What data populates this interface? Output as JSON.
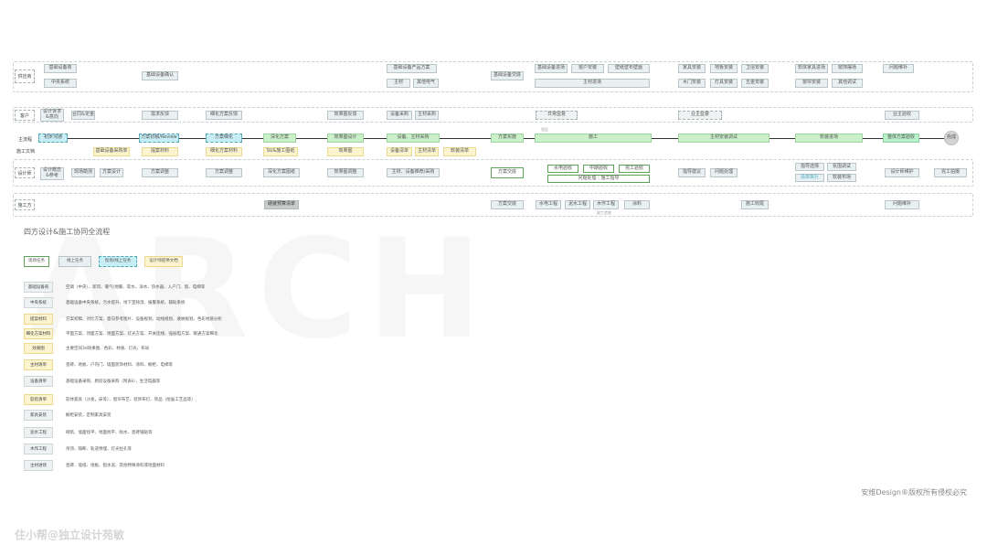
{
  "lanes": {
    "supplier": "供应商",
    "customer": "客户",
    "main_flow": "主流程",
    "designer": "设计师",
    "construction": "施工方",
    "side_main": "主流程",
    "side_doc": "施工文档"
  },
  "supplier_nodes": {
    "basic_equipment": "基础设备商",
    "central_system": "中央系统",
    "basic_confirm": "基础设备确认",
    "basic_product_plan": "基础设备产品方案",
    "main_material": "主材",
    "other_elec": "其他电气",
    "basic_handover": "基础设备交底",
    "basic_entry": "基础设备进场",
    "door_window_install": "窗户安装",
    "wall_cabinet_install": "壁纸壁布壁画",
    "main_material_entry": "主材进场",
    "furniture_install": "家具安装",
    "floor_install": "地板安装",
    "bath_install": "卫浴安装",
    "wood_door_install": "木门安装",
    "lamp_install": "灯具安装",
    "hardware_install": "五金安装",
    "soft_entry": "软体家具进场",
    "curtain": "窗饰摆场",
    "curtain_install": "窗帘安装",
    "other_debug": "其他调试",
    "issue_repair": "问题维补"
  },
  "customer_nodes": {
    "design_intent": "设计诉求\n&意向",
    "contract": "合同&定金",
    "needs_confirm": "需求反馈",
    "deepen_feedback": "细化方案反馈",
    "effect_feedback": "效果图反馈",
    "equip_purchase": "设备采购",
    "main_purchase": "主材采购",
    "daily_supervise": "日常监督",
    "owner_supervise": "业主监督",
    "owner_accept": "业主验收"
  },
  "main_nodes": {
    "first_comm": "初步沟通",
    "plan_proposal": "方案初稿/Review",
    "plan_deepen": "方案细化",
    "deep_plan": "深化方案",
    "effect_design": "效果图设计",
    "equip_main_purchase": "设备、主材采购",
    "plan_implement": "方案实施",
    "construction": "施工",
    "main_install": "主材安装调试",
    "soft_entry": "软装进场",
    "overall_accept": "整体方案验收",
    "finish": "完成",
    "arrow_label": "验证"
  },
  "doc_nodes": {
    "basic_list": "基础设备采购单",
    "proposal_material": "提案材料",
    "deepen_material": "细化方案材料",
    "cad_drawing": "SU&施工图纸",
    "effect_image": "效果图",
    "equip_list": "设备清单",
    "main_list": "主材清单",
    "soft_list": "软装清单"
  },
  "designer_nodes": {
    "design_concept": "设计概念\n&参考",
    "site_survey": "现场勘测",
    "plan_design": "方案设计",
    "plan_adjust": "方案调整",
    "plan_adjust2": "方案调整",
    "deep_drawing": "深化方案图纸",
    "effect_adjust": "效果图调整",
    "main_recommend": "主材、设备推荐/采购",
    "plan_handover": "方案交底",
    "hydro_accept": "水电验收",
    "mid_accept": "中期验收",
    "complete_accept": "完工验收",
    "issue_guide": "问题处理｜施工指导",
    "guide_suggest": "指导建议",
    "issue_handle": "问题处理",
    "guide_select": "指导选择",
    "checklist": "清单执行",
    "fixture_debug": "氛围调试",
    "soft_layout": "软装布场",
    "design_maintain": "设计师维护",
    "finish_shoot": "完工拍摄"
  },
  "construction_nodes": {
    "hard_budget": "硬装预算清单",
    "plan_handover": "方案交底",
    "hydro": "水电工程",
    "tile": "泥水工程",
    "wood": "木作工程",
    "paint": "涂料",
    "finish_clean": "施工收尾",
    "issue_repair": "问题维补",
    "tiny_mark": "竣工验收"
  },
  "section_title": "四方设计&施工协同全流程",
  "legend_types": {
    "offline": "现场任务",
    "online": "线上任务",
    "online_offline": "现场/线上任务",
    "design_doc": "设计师提供文档"
  },
  "legend": [
    {
      "tag": "基础设备商",
      "desc": "空调（中央）、新风、暖气/地暖、软水、净水、热水器、入户门、窗、电梯等",
      "yellow": false
    },
    {
      "tag": "中央系统",
      "desc": "基础设备中央系统，污水提升、地下室除湿、报警系统、辅助系统",
      "yellow": false
    },
    {
      "tag": "提案材料",
      "desc": "方案初稿、对比方案、意向参考图片、设备规划、动线规划、收纳规划、色彩材质分析",
      "yellow": true
    },
    {
      "tag": "细化方案材料",
      "desc": "平面方案、顶面方案、地面方案、灯光方案、开关连线、强弱电方案、暖通方案细化",
      "yellow": true
    },
    {
      "tag": "效果图",
      "desc": "主要空间3d效果图、色彩、材质、灯光、布局",
      "yellow": true
    },
    {
      "tag": "主材清单",
      "desc": "瓷砖、地板、户内门、墙面装饰材料、涂料、橱柜、电梯等",
      "yellow": true
    },
    {
      "tag": "设备清单",
      "desc": "基础设备采购、厨房设备采购（附表ⅱ），生活电器等",
      "yellow": false
    },
    {
      "tag": "软装清单",
      "desc": "软体家具（沙发，床等）、窗帘布艺、装饰布灯、饰品（绘画工艺品等）,",
      "yellow": true
    },
    {
      "tag": "家具安装",
      "desc": "橱柜安装，定制家具安装",
      "yellow": false
    },
    {
      "tag": "泥水工程",
      "desc": "砌筑、墙面找平、地面找平、防水、瓷砖铺贴等",
      "yellow": false
    },
    {
      "tag": "木作工程",
      "desc": "吊顶、隔断、轨道预埋、灯光拉孔等",
      "yellow": false
    },
    {
      "tag": "主材进场",
      "desc": "瓷砖、墙纸、地板、铝水泥、其他特殊涂料或地面材料",
      "yellow": false
    }
  ],
  "copyright": "安维Design®版权所有侵权必究",
  "watermark": "住小帮@独立设计苑敏"
}
